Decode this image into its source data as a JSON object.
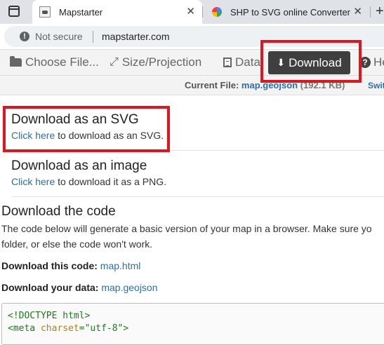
{
  "browser": {
    "tabs": [
      {
        "title": "Mapstarter",
        "favicon": "map-favicon",
        "active": true
      },
      {
        "title": "SHP to SVG online Converter",
        "favicon": "globe-favicon",
        "active": false
      }
    ],
    "close_glyph": "✕",
    "new_tab_glyph": "+",
    "security_label": "Not secure",
    "url": "mapstarter.com"
  },
  "toolbar": {
    "choose_file": "Choose File...",
    "size_projection": "Size/Projection",
    "data": "Data",
    "download": "Download",
    "help": "He",
    "active_item": "download"
  },
  "file_info": {
    "label": "Current File:",
    "name": "map.geojson",
    "size": "(192.1 KB)",
    "switch": "Swit"
  },
  "download_svg": {
    "title": "Download as an SVG",
    "link": "Click here",
    "desc": " to download as an SVG."
  },
  "download_image": {
    "title": "Download as an image",
    "link": "Click here",
    "desc": " to download it as a PNG."
  },
  "download_code": {
    "title": "Download the code",
    "para_line1": "The code below will generate a basic version of your map in a browser. Make sure yo",
    "para_line2": "folder, or else the code won't work.",
    "code_label": "Download this code:",
    "code_link": "map.html",
    "data_label": "Download your data:",
    "data_link": "map.geojson"
  },
  "code": {
    "line1": "<!DOCTYPE html>",
    "line2_tag_open": "<meta ",
    "line2_attr": "charset",
    "line2_eq": "=",
    "line2_val": "\"utf-8\"",
    "line2_tag_close": ">"
  },
  "colors": {
    "highlight": "#e0151f",
    "link": "#2a6fb0",
    "active_button": "#3f3f3f"
  }
}
